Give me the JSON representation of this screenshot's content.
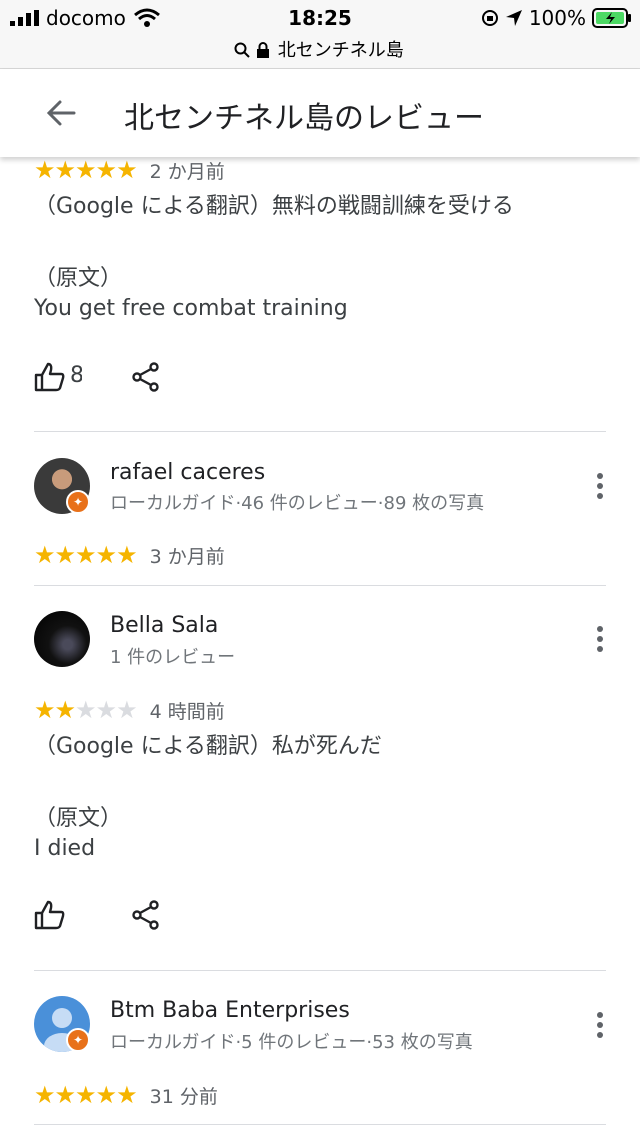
{
  "status_bar": {
    "carrier": "docomo",
    "time": "18:25",
    "battery": "100%"
  },
  "url_bar": {
    "text": "北センチネル島"
  },
  "app_bar": {
    "title": "北センチネル島のレビュー"
  },
  "reviews": [
    {
      "rating": 5,
      "time": "2 か月前",
      "translated": "（Google による翻訳）無料の戦闘訓練を受ける",
      "original_label": "（原文）",
      "original": "You get free combat training",
      "like_count": "8"
    },
    {
      "name": "rafael caceres",
      "meta": "ローカルガイド·46 件のレビュー·89 枚の写真",
      "rating": 5,
      "time": "3 か月前"
    },
    {
      "name": "Bella Sala",
      "meta": "1 件のレビュー",
      "rating": 2,
      "time": "4 時間前",
      "translated": "（Google による翻訳）私が死んだ",
      "original_label": "（原文）",
      "original": "I died"
    },
    {
      "name": "Btm Baba Enterprises",
      "meta": "ローカルガイド·5 件のレビュー·53 枚の写真",
      "rating": 5,
      "time": "31 分前"
    }
  ],
  "colors": {
    "star": "#f5b400",
    "star_empty": "#dadce0",
    "badge": "#e8711a",
    "avatar_default": "#4a90d9"
  },
  "icons": [
    "signal-icon",
    "wifi-icon",
    "lock-icon",
    "search-icon",
    "location-icon",
    "battery-icon",
    "back-arrow-icon",
    "thumbs-up-icon",
    "share-icon",
    "more-vert-icon",
    "local-guide-badge-icon"
  ]
}
